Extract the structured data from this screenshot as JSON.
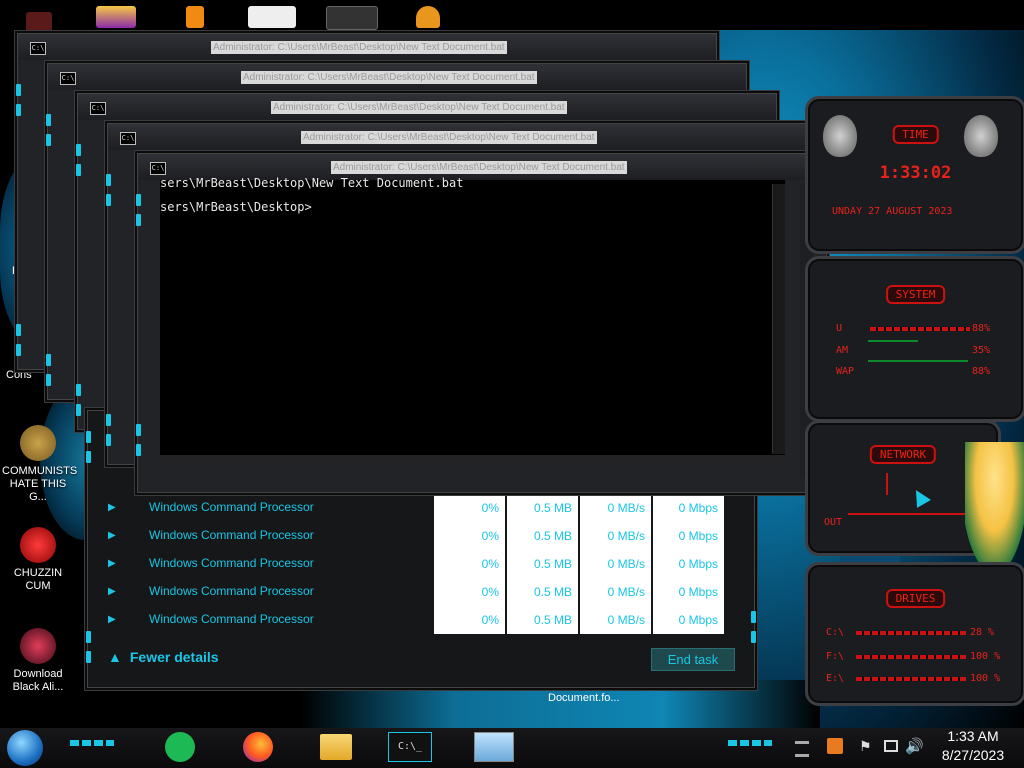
{
  "desktop_icons": [
    {
      "label": "COMMUNISTS HATE THIS G...",
      "icon": "money-bag-icon"
    },
    {
      "label": "CHUZZIN CUM",
      "icon": "red-creature-icon"
    },
    {
      "label": "Download Black Ali...",
      "icon": "alien-orb-icon"
    }
  ],
  "partial_labels": {
    "re": "Re",
    "con": "Cons",
    "doc": "Document.fo..."
  },
  "stacked_window_title": "Administrator: C:\\Users\\MrBeast\\Desktop\\New Text Document.bat",
  "console_lines": [
    "sers\\MrBeast\\Desktop\\New Text Document.bat",
    "sers\\MrBeast\\Desktop>"
  ],
  "task_manager": {
    "rows": [
      {
        "name": "Windows Command Processor",
        "cpu": "0%",
        "memory": "0.5 MB",
        "disk": "0 MB/s",
        "network": "0 Mbps"
      },
      {
        "name": "Windows Command Processor",
        "cpu": "0%",
        "memory": "0.5 MB",
        "disk": "0 MB/s",
        "network": "0 Mbps"
      },
      {
        "name": "Windows Command Processor",
        "cpu": "0%",
        "memory": "0.5 MB",
        "disk": "0 MB/s",
        "network": "0 Mbps"
      },
      {
        "name": "Windows Command Processor",
        "cpu": "0%",
        "memory": "0.5 MB",
        "disk": "0 MB/s",
        "network": "0 Mbps"
      },
      {
        "name": "Windows Command Processor",
        "cpu": "0%",
        "memory": "0.5 MB",
        "disk": "0 MB/s",
        "network": "0 Mbps"
      }
    ],
    "fewer_details": "Fewer details",
    "end_task": "End task"
  },
  "gadgets": {
    "time": {
      "header": "TIME",
      "clock": "1:33:02",
      "date": "UNDAY 27 AUGUST 2023"
    },
    "system": {
      "header": "SYSTEM",
      "rows": [
        {
          "label": "U",
          "value": "88%"
        },
        {
          "label": "AM",
          "value": "35%"
        },
        {
          "label": "WAP",
          "value": "88%"
        }
      ]
    },
    "network": {
      "header": "NETWORK",
      "out": "OUT"
    },
    "drives": {
      "header": "DRIVES",
      "rows": [
        {
          "label": "C:\\",
          "value": "28 %"
        },
        {
          "label": "F:\\",
          "value": "100 %"
        },
        {
          "label": "E:\\",
          "value": "100 %"
        }
      ]
    }
  },
  "taskbar": {
    "time": "1:33 AM",
    "date": "8/27/2023",
    "cmd_label": "C:\\_"
  },
  "colors": {
    "accent": "#19c6e6",
    "gadget_red": "#e8221a"
  }
}
